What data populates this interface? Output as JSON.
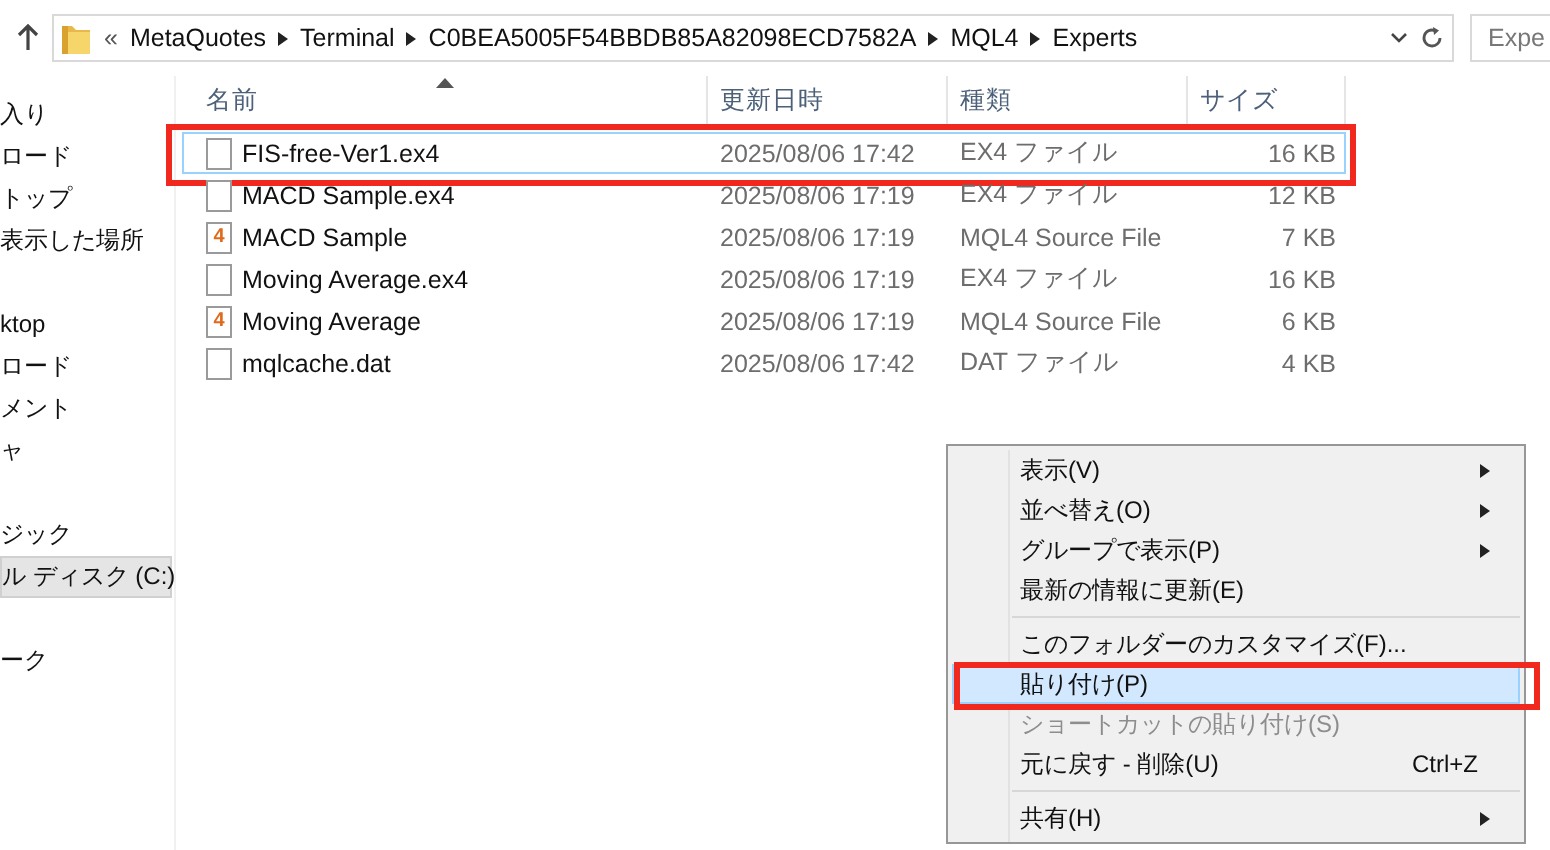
{
  "address_bar": {
    "overflow": "«",
    "path": [
      "MetaQuotes",
      "Terminal",
      "C0BEA5005F54BBDB85A82098ECD7582A",
      "MQL4",
      "Experts"
    ]
  },
  "search": {
    "placeholder": "Expe"
  },
  "nav_pane": {
    "groups": [
      {
        "items": [
          {
            "label": "入り",
            "selected": false
          },
          {
            "label": "ロード",
            "selected": false
          },
          {
            "label": "トップ",
            "selected": false
          },
          {
            "label": "表示した場所",
            "selected": false
          }
        ]
      },
      {
        "items": [
          {
            "label": "ktop",
            "selected": false
          },
          {
            "label": "ロード",
            "selected": false
          },
          {
            "label": "メント",
            "selected": false
          },
          {
            "label": "ャ",
            "selected": false
          }
        ]
      },
      {
        "items": [
          {
            "label": "ジック",
            "selected": false
          },
          {
            "label": "ル ディスク (C:)",
            "selected": true
          }
        ]
      },
      {
        "items": [
          {
            "label": "ーク",
            "selected": false
          }
        ]
      }
    ]
  },
  "file_list": {
    "columns": [
      {
        "label": "名前",
        "sorted": true
      },
      {
        "label": "更新日時",
        "sorted": false
      },
      {
        "label": "種類",
        "sorted": false
      },
      {
        "label": "サイズ",
        "sorted": false
      }
    ],
    "rows": [
      {
        "kind": "plain",
        "name": "FIS-free-Ver1.ex4",
        "date": "2025/08/06 17:42",
        "type": "EX4 ファイル",
        "size": "16 KB",
        "selected": true,
        "highlighted": true
      },
      {
        "kind": "plain",
        "name": "MACD Sample.ex4",
        "date": "2025/08/06 17:19",
        "type": "EX4 ファイル",
        "size": "12 KB",
        "selected": false,
        "highlighted": false
      },
      {
        "kind": "source",
        "icon_label": "4",
        "name": "MACD Sample",
        "date": "2025/08/06 17:19",
        "type": "MQL4 Source File",
        "size": "7 KB",
        "selected": false,
        "highlighted": false
      },
      {
        "kind": "plain",
        "name": "Moving Average.ex4",
        "date": "2025/08/06 17:19",
        "type": "EX4 ファイル",
        "size": "16 KB",
        "selected": false,
        "highlighted": false
      },
      {
        "kind": "source",
        "icon_label": "4",
        "name": "Moving Average",
        "date": "2025/08/06 17:19",
        "type": "MQL4 Source File",
        "size": "6 KB",
        "selected": false,
        "highlighted": false
      },
      {
        "kind": "plain",
        "name": "mqlcache.dat",
        "date": "2025/08/06 17:42",
        "type": "DAT ファイル",
        "size": "4 KB",
        "selected": false,
        "highlighted": false
      }
    ]
  },
  "context_menu": {
    "items": [
      {
        "kind": "item",
        "label": "表示(V)",
        "submenu": true,
        "disabled": false,
        "selected": false,
        "highlighted": false
      },
      {
        "kind": "item",
        "label": "並べ替え(O)",
        "submenu": true,
        "disabled": false,
        "selected": false,
        "highlighted": false
      },
      {
        "kind": "item",
        "label": "グループで表示(P)",
        "submenu": true,
        "disabled": false,
        "selected": false,
        "highlighted": false
      },
      {
        "kind": "item",
        "label": "最新の情報に更新(E)",
        "submenu": false,
        "disabled": false,
        "selected": false,
        "highlighted": false
      },
      {
        "kind": "separator"
      },
      {
        "kind": "item",
        "label": "このフォルダーのカスタマイズ(F)...",
        "submenu": false,
        "disabled": false,
        "selected": false,
        "highlighted": false
      },
      {
        "kind": "item",
        "label": "貼り付け(P)",
        "submenu": false,
        "disabled": false,
        "selected": true,
        "highlighted": true
      },
      {
        "kind": "item",
        "label": "ショートカットの貼り付け(S)",
        "submenu": false,
        "disabled": true,
        "selected": false,
        "highlighted": false
      },
      {
        "kind": "item",
        "label": "元に戻す - 削除(U)",
        "shortcut": "Ctrl+Z",
        "submenu": false,
        "disabled": false,
        "selected": false,
        "highlighted": false
      },
      {
        "kind": "separator"
      },
      {
        "kind": "item",
        "label": "共有(H)",
        "submenu": true,
        "disabled": false,
        "selected": false,
        "highlighted": false
      }
    ]
  }
}
